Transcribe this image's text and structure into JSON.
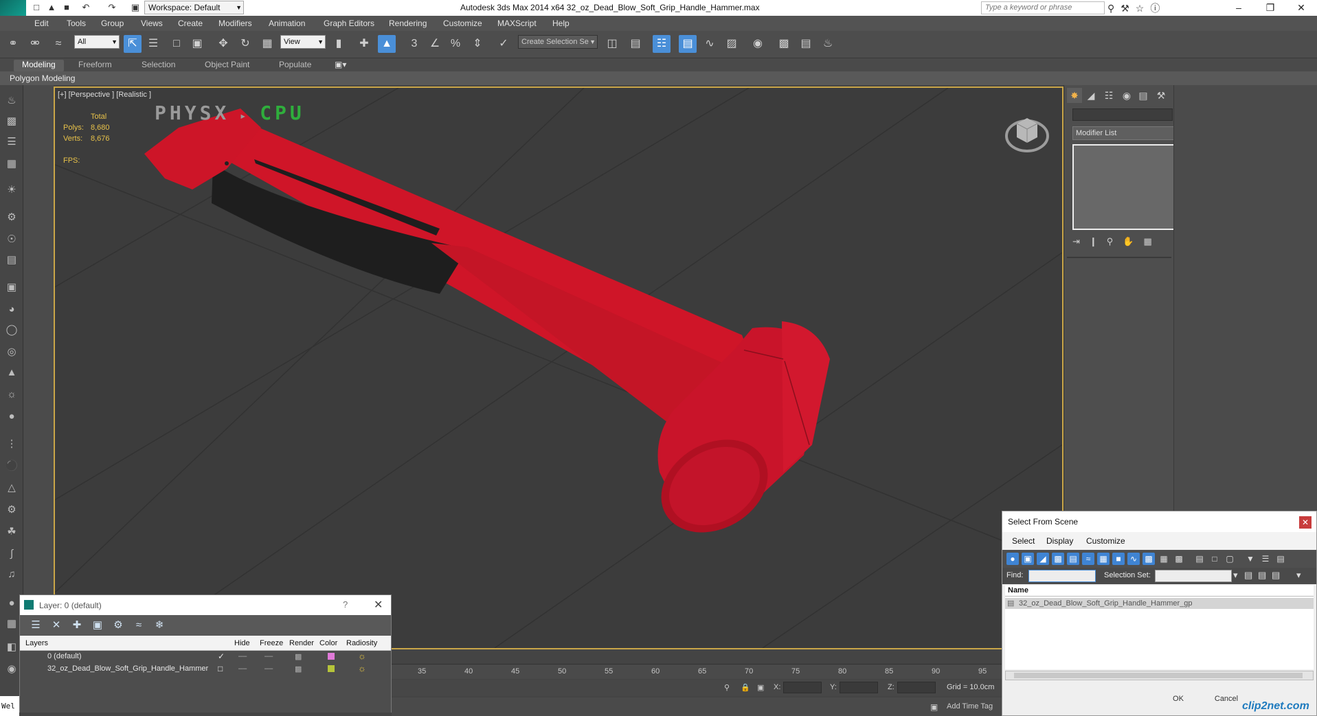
{
  "app": {
    "title": "Autodesk 3ds Max  2014 x64     32_oz_Dead_Blow_Soft_Grip_Handle_Hammer.max",
    "workspace": "Workspace: Default",
    "search_placeholder": "Type a keyword or phrase"
  },
  "menu": [
    "Edit",
    "Tools",
    "Group",
    "Views",
    "Create",
    "Modifiers",
    "Animation",
    "Graph Editors",
    "Rendering",
    "Customize",
    "MAXScript",
    "Help"
  ],
  "toolbar": {
    "filter": "All",
    "ref_coord": "View",
    "selection_set_placeholder": "Create Selection Se"
  },
  "ribbon": {
    "tabs": [
      "Modeling",
      "Freeform",
      "Selection",
      "Object Paint",
      "Populate"
    ],
    "active_tab": "Modeling",
    "panel_label": "Polygon Modeling"
  },
  "viewport": {
    "label": "[+] [Perspective ] [Realistic ]",
    "stats_header": "Total",
    "polys_label": "Polys:",
    "polys_value": "8,680",
    "verts_label": "Verts:",
    "verts_value": "8,676",
    "fps_label": "FPS:",
    "physx_left": "PHYSX",
    "physx_right": "CPU",
    "object_color": "#d81a2c"
  },
  "command_panel": {
    "modifier_list": "Modifier List",
    "object_color": "#d22f7a"
  },
  "timeline": {
    "ticks": [
      "35",
      "40",
      "45",
      "50",
      "55",
      "60",
      "65",
      "70",
      "75",
      "80",
      "85",
      "90",
      "95"
    ]
  },
  "status": {
    "x_label": "X:",
    "y_label": "Y:",
    "z_label": "Z:",
    "grid": "Grid = 10.0cm",
    "add_time_tag": "Add Time Tag",
    "listener": "Wel"
  },
  "layer_dialog": {
    "title": "Layer: 0 (default)",
    "help": "?",
    "columns": [
      "Layers",
      "Hide",
      "Freeze",
      "Render",
      "Color",
      "Radiosity"
    ],
    "rows": [
      {
        "name": "0 (default)",
        "color": "#e07ad8"
      },
      {
        "name": "32_oz_Dead_Blow_Soft_Grip_Handle_Hammer",
        "color": "#b6c43a"
      }
    ]
  },
  "select_from_scene": {
    "title": "Select From Scene",
    "menu": [
      "Select",
      "Display",
      "Customize"
    ],
    "find_label": "Find:",
    "selection_set_label": "Selection Set:",
    "name_header": "Name",
    "items": [
      "32_oz_Dead_Blow_Soft_Grip_Handle_Hammer_gp"
    ],
    "ok": "OK",
    "cancel": "Cancel"
  },
  "watermark": "clip2net.com"
}
